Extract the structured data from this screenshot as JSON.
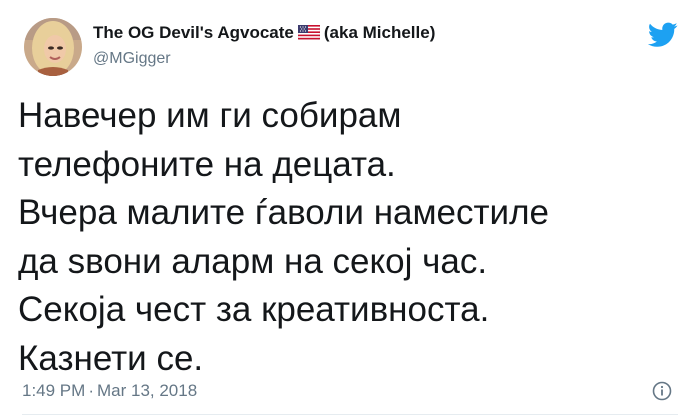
{
  "author": {
    "display_name": "The OG Devil's Agvocate",
    "display_name_suffix": "(aka Michelle)",
    "flag_icon": "us-flag-icon",
    "handle": "@MGigger",
    "avatar_icon": "profile-avatar"
  },
  "brand": {
    "logo_icon": "twitter-bird-icon",
    "accent_color": "#1da1f2"
  },
  "tweet": {
    "lines": [
      "Навечер им ги собирам",
      "телефоните на децата.",
      "Вчера малите ѓаволи наместиле",
      "да ѕвони аларм на секој час.",
      "Секоја чест за креативноста.",
      "Казнети се."
    ]
  },
  "meta": {
    "time": "1:49 PM",
    "separator": "·",
    "date": "Mar 13, 2018",
    "info_icon": "info-icon"
  }
}
